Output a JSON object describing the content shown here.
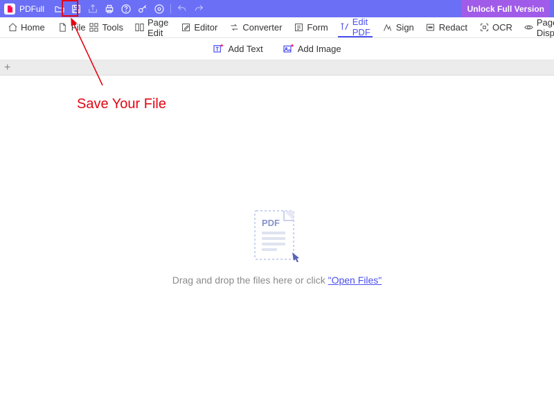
{
  "app": {
    "name": "PDFull",
    "unlock_label": "Unlock Full Version"
  },
  "annotation": {
    "text": "Save Your File"
  },
  "menubar": {
    "home": "Home",
    "file": "File",
    "tools": "Tools",
    "page_edit": "Page Edit",
    "editor": "Editor",
    "converter": "Converter",
    "form": "Form",
    "edit_pdf": "Edit PDF",
    "sign": "Sign",
    "redact": "Redact",
    "ocr": "OCR",
    "page_display": "Page Display"
  },
  "subbar": {
    "add_text": "Add Text",
    "add_image": "Add Image"
  },
  "droparea": {
    "pdf_badge": "PDF",
    "prompt_prefix": "Drag and drop the files here or click ",
    "open_files": "\"Open Files\""
  }
}
